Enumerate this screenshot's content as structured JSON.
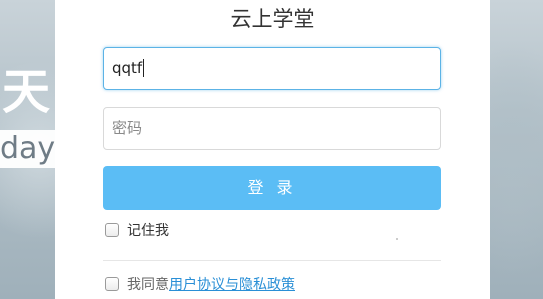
{
  "app": {
    "title": "云上学堂"
  },
  "background": {
    "char": "天",
    "word": "day"
  },
  "form": {
    "username_value": "qqtf",
    "password_placeholder": "密码",
    "login_label": "登 录",
    "remember_label": "记住我",
    "agree_prefix": "我同意",
    "agree_link": "用户协议与隐私政策"
  },
  "colors": {
    "accent": "#5bbdf5",
    "link": "#2a8fd6",
    "focus_border": "#5cb3e6"
  }
}
